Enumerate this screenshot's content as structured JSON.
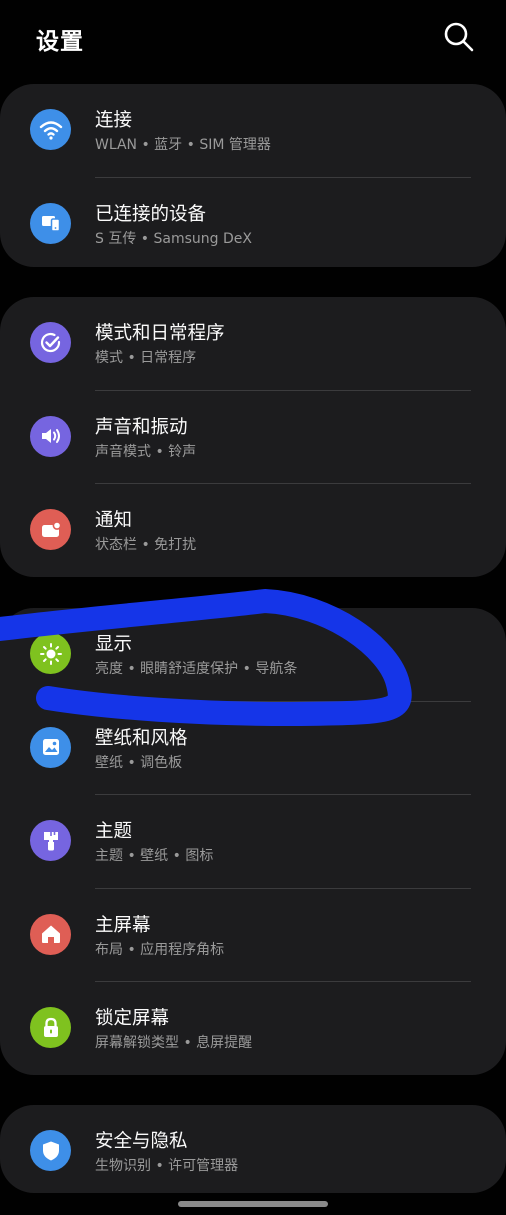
{
  "header": {
    "title": "设置",
    "search_icon": "search-icon"
  },
  "groups": [
    {
      "items": [
        {
          "name": "connections",
          "label": "连接",
          "sub": "WLAN • 蓝牙 • SIM 管理器",
          "icon": "wifi-icon",
          "color": "#3e8fe8"
        },
        {
          "name": "connected-devices",
          "label": "已连接的设备",
          "sub": "S 互传 • Samsung DeX",
          "icon": "devices-icon",
          "color": "#3e8fe8"
        }
      ]
    },
    {
      "items": [
        {
          "name": "modes-routines",
          "label": "模式和日常程序",
          "sub": "模式 • 日常程序",
          "icon": "check-circle-icon",
          "color": "#7665e0"
        },
        {
          "name": "sounds-vibration",
          "label": "声音和振动",
          "sub": "声音模式 • 铃声",
          "icon": "volume-icon",
          "color": "#7665e0"
        },
        {
          "name": "notifications",
          "label": "通知",
          "sub": "状态栏 • 免打扰",
          "icon": "notification-icon",
          "color": "#df5e55"
        }
      ]
    },
    {
      "items": [
        {
          "name": "display",
          "label": "显示",
          "sub": "亮度 • 眼睛舒适度保护 • 导航条",
          "icon": "brightness-icon",
          "color": "#7fc21f"
        },
        {
          "name": "wallpaper-style",
          "label": "壁纸和风格",
          "sub": "壁纸 • 调色板",
          "icon": "image-icon",
          "color": "#3e8fe8"
        },
        {
          "name": "themes",
          "label": "主题",
          "sub": "主题 • 壁纸 • 图标",
          "icon": "paint-brush-icon",
          "color": "#7665e0"
        },
        {
          "name": "home-screen",
          "label": "主屏幕",
          "sub": "布局 • 应用程序角标",
          "icon": "home-icon",
          "color": "#df5e55"
        },
        {
          "name": "lock-screen",
          "label": "锁定屏幕",
          "sub": "屏幕解锁类型 • 息屏提醒",
          "icon": "lock-icon",
          "color": "#7fc21f"
        }
      ]
    },
    {
      "items": [
        {
          "name": "security-privacy",
          "label": "安全与隐私",
          "sub": "生物识别 • 许可管理器",
          "icon": "shield-icon",
          "color": "#3e8fe8"
        }
      ]
    }
  ],
  "annotation": {
    "stroke_color": "#1535e8"
  }
}
